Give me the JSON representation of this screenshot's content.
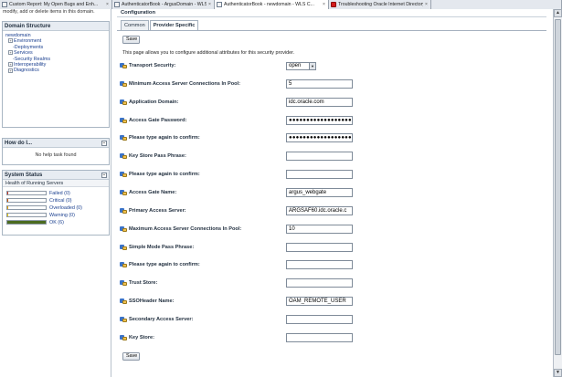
{
  "browser_tabs": [
    {
      "label": "Custom Report: My Open Bugs and Enh...",
      "width": 123,
      "active": false,
      "red": false
    },
    {
      "label": "AuthenticatorBook - ArgusDomain - WLS ...",
      "width": 112,
      "active": false,
      "red": false
    },
    {
      "label": "AuthenticatorBook - newdomain - WLS C...",
      "width": 125,
      "active": true,
      "red": false
    },
    {
      "label": "Troubleshooting Oracle Internet Directory ...",
      "width": 112,
      "active": false,
      "red": true
    },
    {
      "label": "",
      "width": 143,
      "active": false,
      "red": false
    }
  ],
  "left": {
    "help_snippet": "modify, add or delete items in this domain.",
    "domain_structure": {
      "title": "Domain Structure",
      "root": "newdomain",
      "items": [
        "Environment",
        "Deployments",
        "Services",
        "Security Realms",
        "Interoperability",
        "Diagnostics"
      ]
    },
    "how_do_i": {
      "title": "How do I...",
      "text": "No help task found"
    },
    "system_status": {
      "title": "System Status",
      "subtitle": "Health of Running Servers",
      "rows": [
        {
          "label": "Failed (0)",
          "fraction": 0,
          "color": "#c0392b"
        },
        {
          "label": "Critical (0)",
          "fraction": 0,
          "color": "#d35400"
        },
        {
          "label": "Overloaded (0)",
          "fraction": 0,
          "color": "#e6a100"
        },
        {
          "label": "Warning (0)",
          "fraction": 0,
          "color": "#e6c700"
        },
        {
          "label": "OK (6)",
          "fraction": 1,
          "color": "#4b6b1f"
        }
      ]
    }
  },
  "main": {
    "title": "Configuration",
    "tabs": [
      {
        "label": "Common",
        "active": false
      },
      {
        "label": "Provider Specific",
        "active": true
      }
    ],
    "save_label": "Save",
    "intro": "This page allows you to configure additional attributes for this security provider.",
    "fields": [
      {
        "label": "Transport Security:",
        "type": "select",
        "value": "open"
      },
      {
        "label": "Minimum Access Server Connections In Pool:",
        "type": "text",
        "value": "5"
      },
      {
        "label": "Application Domain:",
        "type": "text",
        "value": "idc.oracle.com"
      },
      {
        "label": "Access Gate Password:",
        "type": "password",
        "value": "●●●●●●●●●●●●●●●●●●●●●"
      },
      {
        "label": "Please type again to confirm:",
        "type": "password",
        "value": "●●●●●●●●●●●●●●●●●●●●●"
      },
      {
        "label": "Key Store Pass Phrase:",
        "type": "text",
        "value": ""
      },
      {
        "label": "Please type again to confirm:",
        "type": "text",
        "value": ""
      },
      {
        "label": "Access Gate Name:",
        "type": "text",
        "value": "argus_webgate"
      },
      {
        "label": "Primary Access Server:",
        "type": "text",
        "value": "ARGSAF60.idc.oracle.c"
      },
      {
        "label": "Maximum Access Server Connections In Pool:",
        "type": "text",
        "value": "10"
      },
      {
        "label": "Simple Mode Pass Phrase:",
        "type": "text",
        "value": ""
      },
      {
        "label": "Please type again to confirm:",
        "type": "text",
        "value": ""
      },
      {
        "label": "Trust Store:",
        "type": "text",
        "value": ""
      },
      {
        "label": "SSOHeader Name:",
        "type": "text",
        "value": "OAM_REMOTE_USER"
      },
      {
        "label": "Secondary Access Server:",
        "type": "text",
        "value": ""
      },
      {
        "label": "Key Store:",
        "type": "text",
        "value": ""
      }
    ]
  }
}
